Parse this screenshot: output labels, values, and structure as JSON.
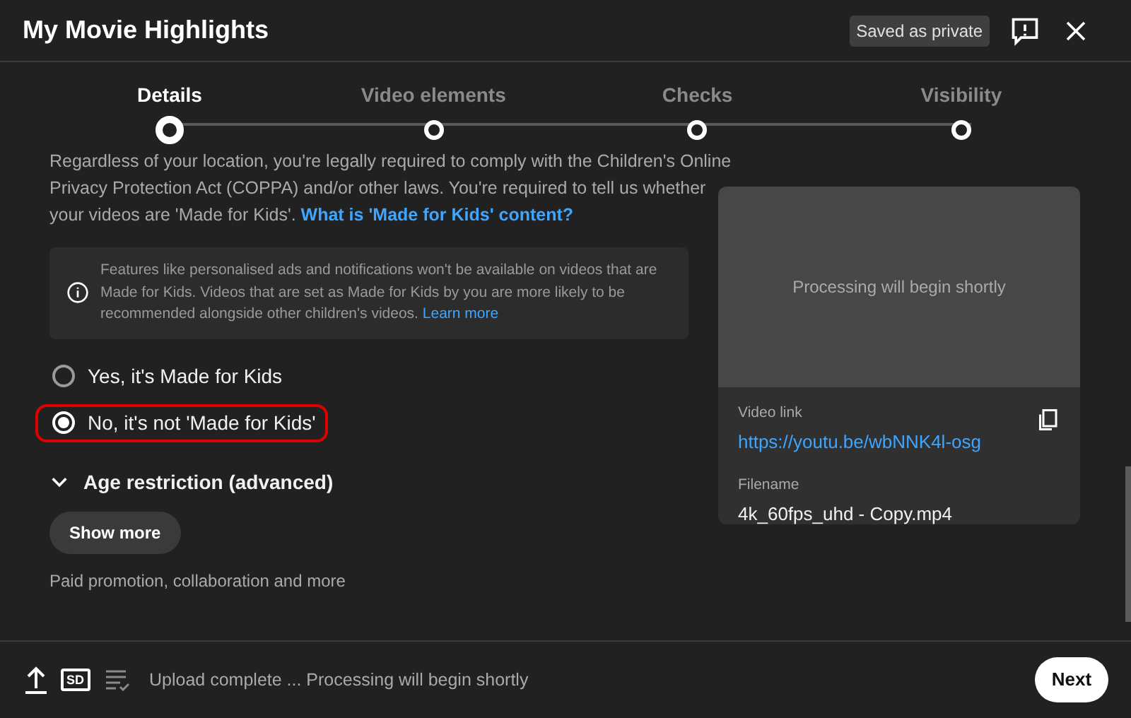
{
  "window": {
    "title": "My Movie Highlights",
    "badge": "Saved as private"
  },
  "steps": [
    {
      "label": "Details",
      "selected": true
    },
    {
      "label": "Video elements",
      "selected": false
    },
    {
      "label": "Checks",
      "selected": false
    },
    {
      "label": "Visibility",
      "selected": false
    }
  ],
  "audience": {
    "intro": "Regardless of your location, you're legally required to comply with the Children's Online Privacy Protection Act (COPPA) and/or other laws. You're required to tell us whether your videos are 'Made for Kids'.",
    "intro_link": "What is 'Made for Kids' content?",
    "notice": "Features like personalised ads and notifications won't be available on videos that are Made for Kids. Videos that are set as Made for Kids by you are more likely to be recommended alongside other children's videos.",
    "notice_link": "Learn more",
    "options": [
      {
        "label": "Yes, it's Made for Kids",
        "selected": false,
        "highlighted": false
      },
      {
        "label": "No, it's not 'Made for Kids'",
        "selected": true,
        "highlighted": true
      }
    ]
  },
  "age_restriction": {
    "label": "Age restriction (advanced)",
    "expanded": false
  },
  "show_more": {
    "label": "Show more",
    "hint": "Paid promotion, collaboration and more"
  },
  "preview": {
    "message": "Processing will begin shortly",
    "link_label": "Video link",
    "link": "https://youtu.be/wbNNK4l-osg",
    "filename_label": "Filename",
    "filename": "4k_60fps_uhd - Copy.mp4"
  },
  "footer": {
    "sd_badge": "SD",
    "status": "Upload complete ... Processing will begin shortly",
    "next": "Next"
  }
}
